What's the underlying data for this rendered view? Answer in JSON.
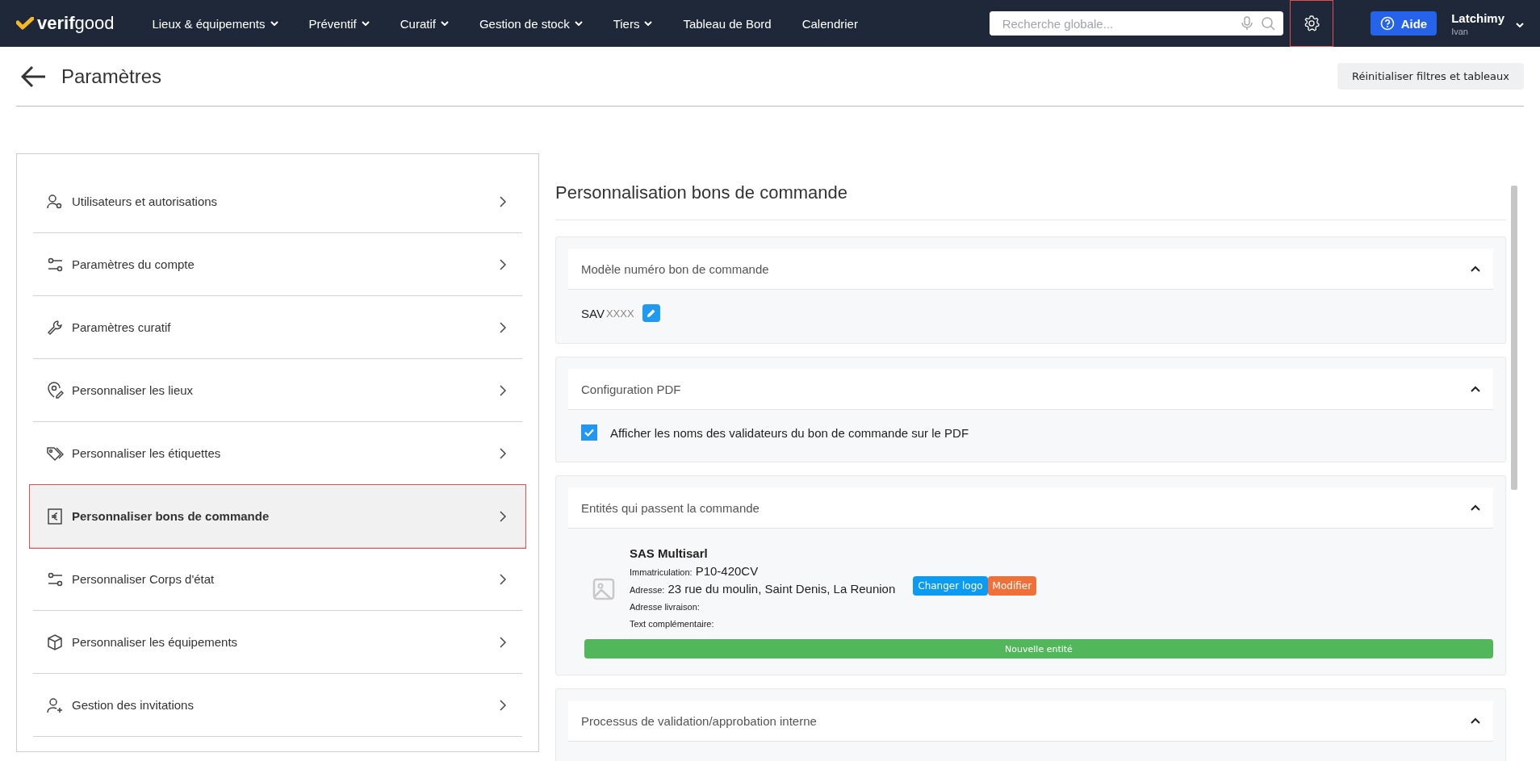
{
  "topbar": {
    "logo": {
      "bold": "verif",
      "light": "good"
    },
    "nav": [
      {
        "label": "Lieux & équipements",
        "has_menu": true
      },
      {
        "label": "Préventif",
        "has_menu": true
      },
      {
        "label": "Curatif",
        "has_menu": true
      },
      {
        "label": "Gestion de stock",
        "has_menu": true
      },
      {
        "label": "Tiers",
        "has_menu": true
      },
      {
        "label": "Tableau de Bord",
        "has_menu": false
      },
      {
        "label": "Calendrier",
        "has_menu": false
      }
    ],
    "search": {
      "placeholder": "Recherche globale..."
    },
    "settings": {
      "selected": true
    },
    "help_button": "Aide",
    "user": {
      "name": "Latchimy",
      "sub": "Ivan"
    }
  },
  "page": {
    "title": "Paramètres",
    "reset_button": "Réinitialiser filtres et tableaux"
  },
  "sidebar": {
    "items": [
      {
        "label": "Utilisateurs et autorisations",
        "kind": "user-gear",
        "selected": false
      },
      {
        "label": "Paramètres du compte",
        "kind": "sliders",
        "selected": false
      },
      {
        "label": "Paramètres curatif",
        "kind": "wrench",
        "selected": false
      },
      {
        "label": "Personnaliser les lieux",
        "kind": "pin",
        "selected": false
      },
      {
        "label": "Personnaliser les étiquettes",
        "kind": "tags",
        "selected": false
      },
      {
        "label": "Personnaliser bons de commande",
        "kind": "receipt",
        "selected": true
      },
      {
        "label": "Personnaliser Corps d'état",
        "kind": "sliders",
        "selected": false
      },
      {
        "label": "Personnaliser les équipements",
        "kind": "cube",
        "selected": false
      },
      {
        "label": "Gestion des invitations",
        "kind": "user-plus",
        "selected": false
      }
    ]
  },
  "panel": {
    "title": "Personnalisation bons de commande",
    "sections": [
      {
        "kind": "template",
        "title": "Modèle numéro bon de commande",
        "expanded": true,
        "prefix": "SAV",
        "suffix": "XXXX"
      },
      {
        "kind": "checkbox",
        "title": "Configuration PDF",
        "expanded": true,
        "label": "Afficher les noms des validateurs du bon de commande sur le PDF",
        "checked": true
      },
      {
        "kind": "entities",
        "title": "Entités qui passent la commande",
        "expanded": true,
        "entities": [
          {
            "name": "SAS Multisarl",
            "fields": [
              {
                "label": "Immatriculation:",
                "value": "P10-420CV"
              },
              {
                "label": "Adresse:",
                "value": "23 rue du moulin, Saint Denis, La Reunion"
              },
              {
                "label": "Adresse livraison:"
              },
              {
                "label": "Text complémentaire:"
              }
            ],
            "logo_button": "Changer logo",
            "edit_button": "Modifier"
          }
        ],
        "add_button": "Nouvelle entité"
      },
      {
        "kind": "plain",
        "title": "Processus de validation/approbation interne",
        "expanded": true
      }
    ]
  }
}
